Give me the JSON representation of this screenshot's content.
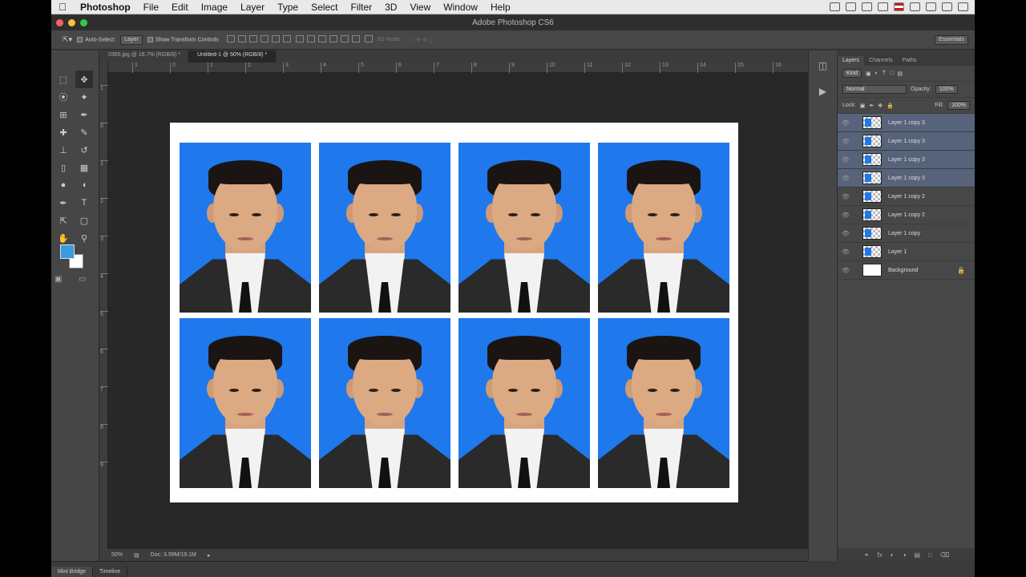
{
  "menubar": {
    "app": "Photoshop",
    "items": [
      "File",
      "Edit",
      "Image",
      "Layer",
      "Type",
      "Select",
      "Filter",
      "3D",
      "View",
      "Window",
      "Help"
    ]
  },
  "window": {
    "title": "Adobe Photoshop CS6"
  },
  "options": {
    "auto_select_label": "Auto-Select:",
    "auto_select_value": "Layer",
    "transform_label": "Show Transform Controls",
    "mode3d_label": "3D Mode:",
    "workspace": "Essentials"
  },
  "tabs": [
    {
      "label": "0365.jpg @ 16.7% (RGB/8) *",
      "active": false
    },
    {
      "label": "Untitled-1 @ 50% (RGB/8) *",
      "active": true
    }
  ],
  "ruler": {
    "h": [
      "1",
      "0",
      "1",
      "2",
      "3",
      "4",
      "5",
      "6",
      "7",
      "8",
      "9",
      "10",
      "11",
      "12",
      "13",
      "14",
      "15",
      "16"
    ],
    "v": [
      "1",
      "0",
      "1",
      "2",
      "3",
      "4",
      "5",
      "6",
      "7",
      "8",
      "9"
    ]
  },
  "status": {
    "zoom": "50%",
    "doc": "Doc: 3.99M/19.1M"
  },
  "bottom_tabs": [
    "Mini Bridge",
    "Timeline"
  ],
  "panels": {
    "tabs": [
      "Layers",
      "Channels",
      "Paths"
    ],
    "filter_kind": "Kind",
    "blend_mode": "Normal",
    "opacity_label": "Opacity:",
    "opacity_value": "100%",
    "lock_label": "Lock:",
    "fill_label": "Fill:",
    "fill_value": "100%"
  },
  "layers": [
    {
      "name": "Layer 1 copy 3",
      "selected": true
    },
    {
      "name": "Layer 1 copy 3",
      "selected": true
    },
    {
      "name": "Layer 1 copy 3",
      "selected": true
    },
    {
      "name": "Layer 1 copy 3",
      "selected": true
    },
    {
      "name": "Layer 1 copy 2",
      "selected": false
    },
    {
      "name": "Layer 1 copy 2",
      "selected": false
    },
    {
      "name": "Layer 1 copy",
      "selected": false
    },
    {
      "name": "Layer 1",
      "selected": false
    },
    {
      "name": "Background",
      "selected": false,
      "locked": true
    }
  ],
  "colors": {
    "foreground": "#3a9be0",
    "background": "#ffffff",
    "photo_bg": "#1f78ec"
  }
}
